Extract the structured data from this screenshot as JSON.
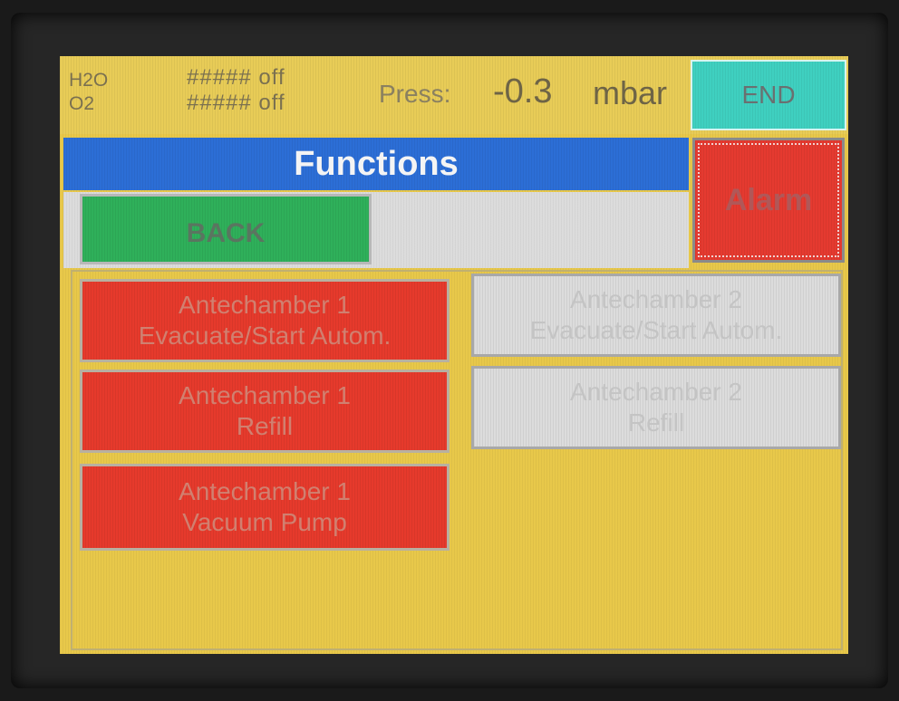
{
  "status_bar": {
    "gas_labels": [
      "H2O",
      "O2"
    ],
    "gas_values": [
      "##### off",
      "##### off"
    ],
    "pressure_label": "Press:",
    "pressure_value": "-0.3",
    "pressure_unit": "mbar",
    "end_label": "END"
  },
  "header": {
    "title": "Functions",
    "back_label": "BACK",
    "alarm_label": "Alarm"
  },
  "functions": [
    {
      "line1": "Antechamber 1",
      "line2": "Evacuate/Start Autom.",
      "state": "active",
      "color": "#e63a2c"
    },
    {
      "line1": "Antechamber 2",
      "line2": "Evacuate/Start Autom.",
      "state": "disabled",
      "color": "#dcdcdc"
    },
    {
      "line1": "Antechamber 1",
      "line2": "Refill",
      "state": "active",
      "color": "#e63a2c"
    },
    {
      "line1": "Antechamber 2",
      "line2": "Refill",
      "state": "disabled",
      "color": "#dcdcdc"
    },
    {
      "line1": "Antechamber 1",
      "line2": "Vacuum Pump",
      "state": "active",
      "color": "#e63a2c"
    }
  ],
  "colors": {
    "background": "#e8c84a",
    "title_bar": "#2c6ed6",
    "end_button": "#3fd0c0",
    "back_button": "#2fb05a",
    "alarm_button": "#e53a30"
  }
}
